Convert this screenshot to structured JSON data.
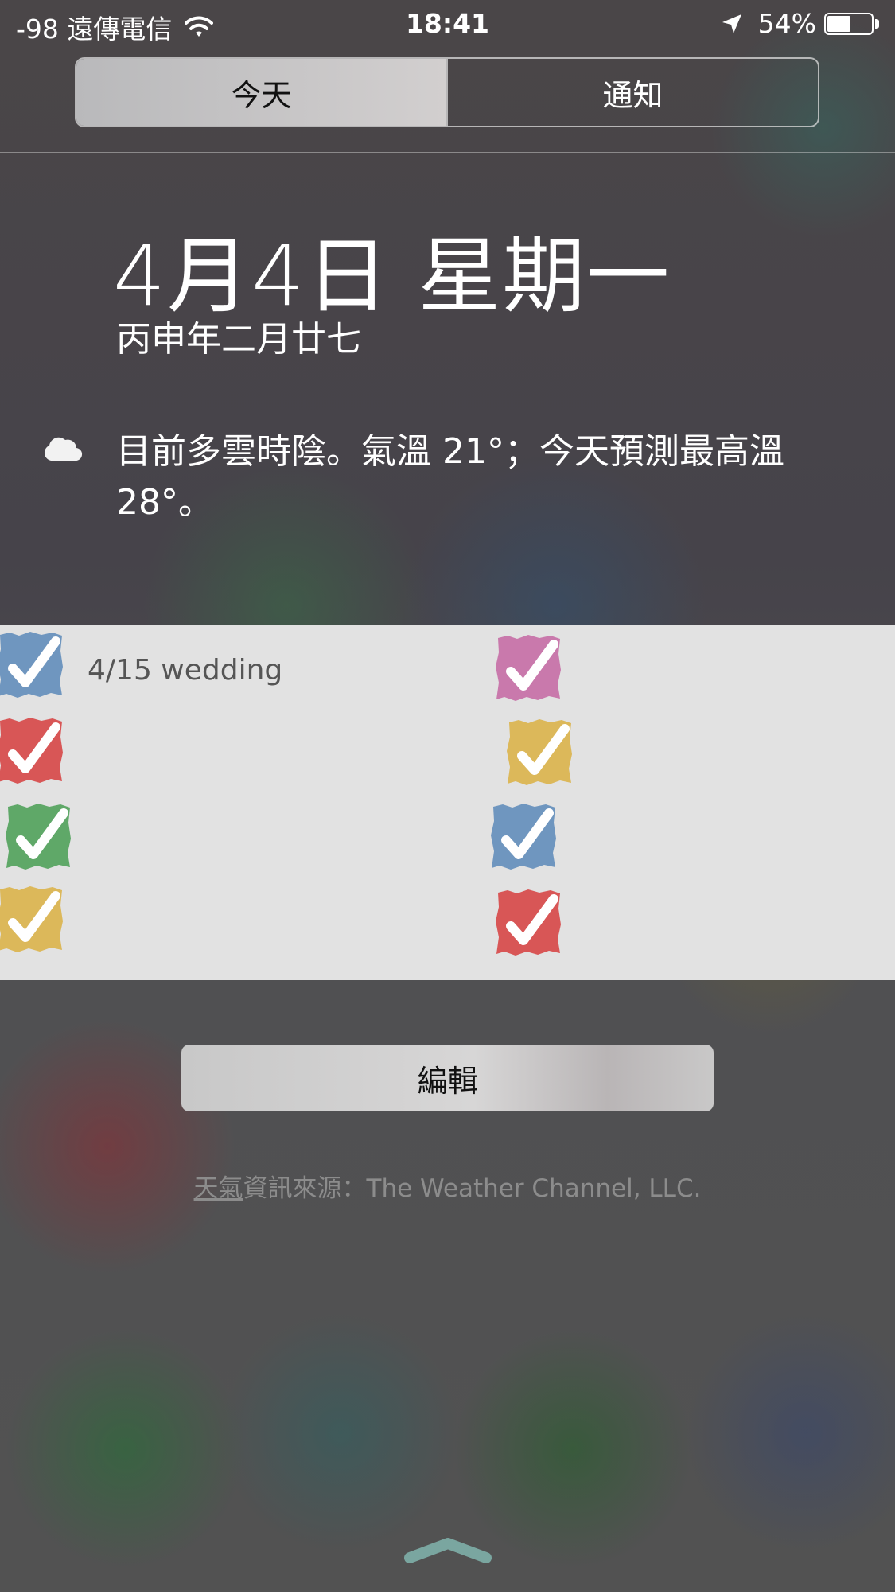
{
  "status_bar": {
    "carrier": "-98 遠傳電信",
    "time": "18:41",
    "battery": "54%",
    "battery_level": 0.54,
    "icons": [
      "wifi-icon",
      "location-arrow-icon",
      "battery-icon"
    ]
  },
  "tabs": [
    {
      "label": "今天",
      "active": true
    },
    {
      "label": "通知",
      "active": false
    }
  ],
  "today": {
    "date": "4月4日 星期一",
    "lunar_date": "丙申年二月廿七",
    "weather_icon": "cloud-icon",
    "weather_text": "目前多雲時陰。氣溫 21°；今天預測最高溫 28°。"
  },
  "widget": {
    "background": "#e2e2e2",
    "first_task_label": "4/15 wedding",
    "tasks": [
      {
        "color": "#6f96bf",
        "checked": true
      },
      {
        "color": "#d85656",
        "checked": true
      },
      {
        "color": "#5fa868",
        "checked": true
      },
      {
        "color": "#dcb85a",
        "checked": true
      },
      {
        "color": "#c979ac",
        "checked": true
      },
      {
        "color": "#dcb85a",
        "checked": true
      },
      {
        "color": "#6f96bf",
        "checked": true
      },
      {
        "color": "#d85656",
        "checked": true
      }
    ]
  },
  "edit_button": {
    "label": "編輯"
  },
  "attribution": {
    "link_text": "天氣",
    "text": "資訊來源：The Weather Channel, LLC."
  },
  "bottom": {
    "icon": "grabber-chevron-icon"
  }
}
